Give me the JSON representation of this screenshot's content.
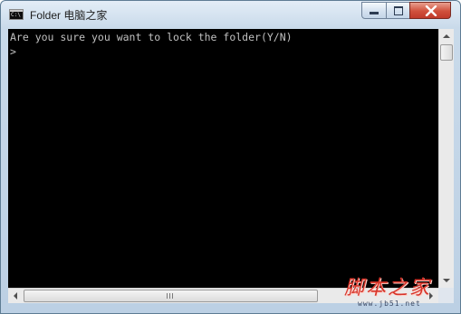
{
  "window": {
    "title": "Folder 电脑之家",
    "icon_glyph": "C:\\",
    "controls": {
      "minimize": "minimize-icon",
      "maximize": "maximize-icon",
      "close": "close-icon"
    }
  },
  "console": {
    "lines": [
      "Are you sure you want to lock the folder(Y/N)",
      ">"
    ],
    "text_color": "#c0c0c0",
    "background": "#000000"
  },
  "watermark": {
    "text": "脚本之家",
    "url": "www.jb51.net",
    "color": "#d8352a"
  }
}
